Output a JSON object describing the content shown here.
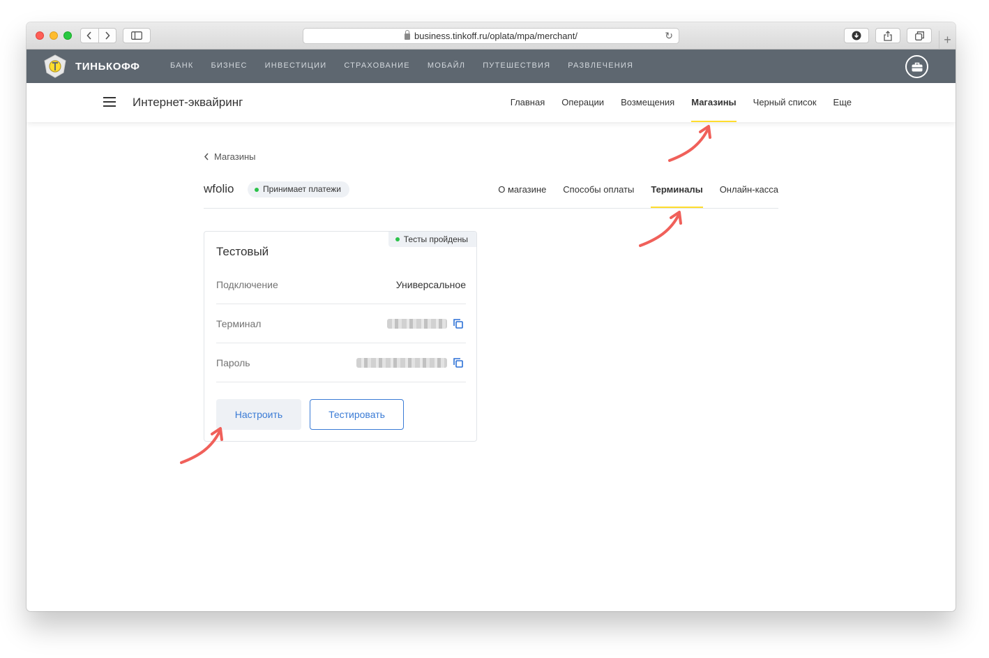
{
  "browser": {
    "url": "business.tinkoff.ru/oplata/mpa/merchant/"
  },
  "topbar": {
    "brand": "ТИНЬКОФФ",
    "nav": [
      "БАНК",
      "БИЗНЕС",
      "ИНВЕСТИЦИИ",
      "СТРАХОВАНИЕ",
      "МОБАЙЛ",
      "ПУТЕШЕСТВИЯ",
      "РАЗВЛЕЧЕНИЯ"
    ]
  },
  "subheader": {
    "title": "Интернет-эквайринг",
    "nav": [
      {
        "label": "Главная",
        "active": false
      },
      {
        "label": "Операции",
        "active": false
      },
      {
        "label": "Возмещения",
        "active": false
      },
      {
        "label": "Магазины",
        "active": true
      },
      {
        "label": "Черный список",
        "active": false
      },
      {
        "label": "Еще",
        "active": false
      }
    ]
  },
  "shop": {
    "breadcrumb": "Магазины",
    "name": "wfolio",
    "status": "Принимает платежи",
    "tabs": [
      {
        "label": "О магазине",
        "active": false
      },
      {
        "label": "Способы оплаты",
        "active": false
      },
      {
        "label": "Терминалы",
        "active": true
      },
      {
        "label": "Онлайн-касса",
        "active": false
      }
    ]
  },
  "terminal_card": {
    "badge": "Тесты пройдены",
    "title": "Тестовый",
    "rows": [
      {
        "label": "Подключение",
        "value": "Универсальное"
      },
      {
        "label": "Терминал",
        "value": ""
      },
      {
        "label": "Пароль",
        "value": ""
      }
    ],
    "configure_label": "Настроить",
    "test_label": "Тестировать"
  },
  "colors": {
    "topbar_bg": "#5e6770",
    "accent_yellow": "#ffdd2d",
    "link_blue": "#3a7bd5",
    "status_green": "#2bc24a",
    "annotation_arrow": "#f0605a"
  }
}
